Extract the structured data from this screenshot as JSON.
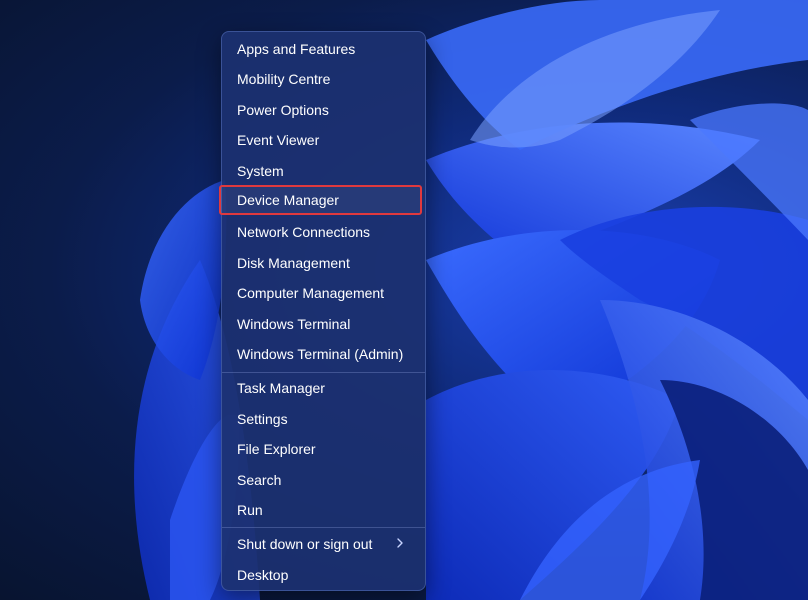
{
  "menu": {
    "items": [
      {
        "label": "Apps and Features"
      },
      {
        "label": "Mobility Centre"
      },
      {
        "label": "Power Options"
      },
      {
        "label": "Event Viewer"
      },
      {
        "label": "System"
      },
      {
        "label": "Device Manager",
        "highlighted": true
      },
      {
        "label": "Network Connections"
      },
      {
        "label": "Disk Management"
      },
      {
        "label": "Computer Management"
      },
      {
        "label": "Windows Terminal"
      },
      {
        "label": "Windows Terminal (Admin)"
      },
      {
        "label": "Task Manager"
      },
      {
        "label": "Settings"
      },
      {
        "label": "File Explorer"
      },
      {
        "label": "Search"
      },
      {
        "label": "Run"
      },
      {
        "label": "Shut down or sign out",
        "has_submenu": true
      },
      {
        "label": "Desktop"
      }
    ]
  },
  "colors": {
    "highlight_border": "#e0393e",
    "menu_background": "#1c3070",
    "text": "#ffffff"
  },
  "icons": {
    "submenu": "chevron-right-icon"
  }
}
